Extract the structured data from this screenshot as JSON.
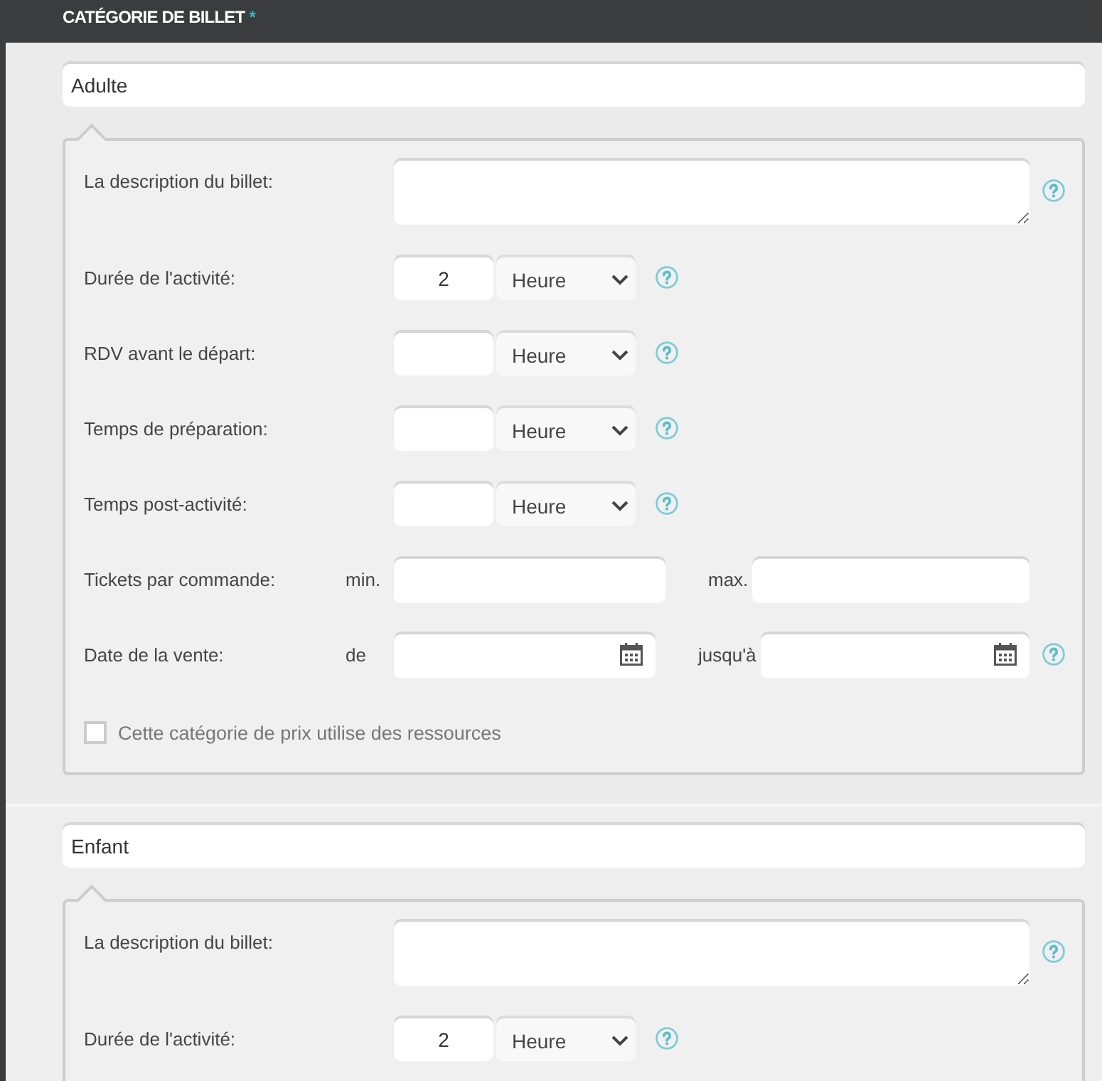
{
  "header": {
    "title": "CATÉGORIE DE BILLET",
    "required_mark": "*"
  },
  "categories": [
    {
      "name": "Adulte",
      "fields": [
        {
          "kind": "textarea",
          "label": "La description du billet:",
          "help": true
        },
        {
          "kind": "duration",
          "label": "Durée de l'activité:",
          "value": "2",
          "unit": "Heure",
          "help": true
        },
        {
          "kind": "duration",
          "label": "RDV avant le départ:",
          "unit": "Heure",
          "help": true
        },
        {
          "kind": "duration",
          "label": "Temps de préparation:",
          "unit": "Heure",
          "help": true
        },
        {
          "kind": "duration",
          "label": "Temps post-activité:",
          "unit": "Heure",
          "help": true
        },
        {
          "kind": "range",
          "label": "Tickets par commande:",
          "from_label": "min.",
          "to_label": "max."
        },
        {
          "kind": "date_range",
          "label": "Date de la vente:",
          "from_label": "de",
          "to_label": "jusqu'à",
          "help": true
        },
        {
          "kind": "checkbox",
          "label": "Cette catégorie de prix utilise des ressources",
          "checked": false
        }
      ]
    },
    {
      "name": "Enfant",
      "fields": [
        {
          "kind": "textarea",
          "label": "La description du billet:",
          "help": true
        },
        {
          "kind": "duration",
          "label": "Durée de l'activité:",
          "value": "2",
          "unit": "Heure",
          "help": true
        }
      ]
    }
  ]
}
